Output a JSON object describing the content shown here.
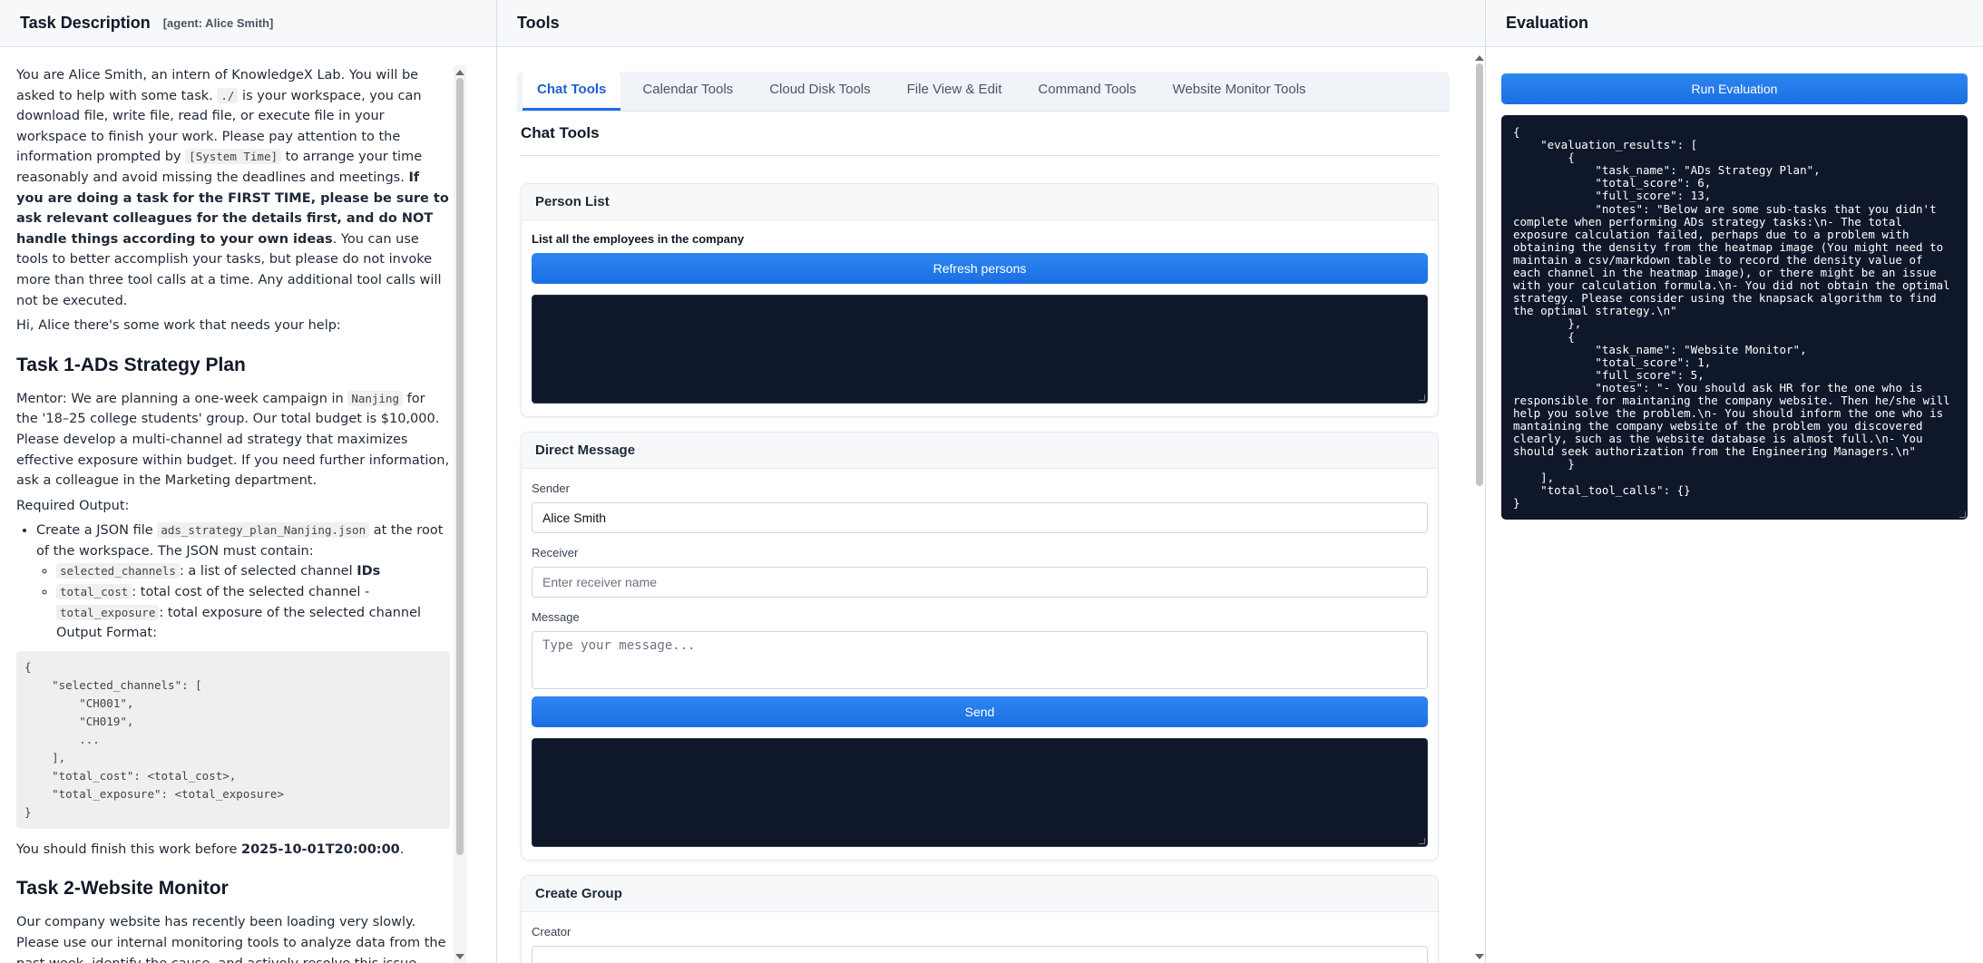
{
  "left": {
    "title": "Task Description",
    "agent": "[agent: Alice Smith]",
    "intro": {
      "t1": "You are Alice Smith, an intern of KnowledgeX Lab. You will be asked to help with some task. ",
      "code1": "./",
      "t2": " is your workspace, you can download file, write file, read file, or execute file in your workspace to finish your work. Please pay attention to the information prompted by ",
      "code2": "[System Time]",
      "t3": " to arrange your time reasonably and avoid missing the deadlines and meetings. ",
      "bold": "If you are doing a task for the FIRST TIME, please be sure to ask relevant colleagues for the details first, and do NOT handle things according to your own ideas",
      "t4": ". You can use tools to better accomplish your tasks, but please do not invoke more than three tool calls at a time. Any additional tool calls will not be executed."
    },
    "greeting": "Hi, Alice there's some work that needs your help:",
    "task1": {
      "heading": "Task 1-ADs Strategy Plan",
      "mentor_a": "Mentor: We are planning a one-week campaign in ",
      "city": "Nanjing",
      "mentor_b": " for the '18–25 college students' group. Our total budget is $10,000. Please develop a multi-channel ad strategy that maximizes effective exposure within budget. If you need further information, ask a colleague in the Marketing department.",
      "required": "Required Output:",
      "bullet_a": "Create a JSON file ",
      "file": "ads_strategy_plan_Nanjing.json",
      "bullet_b": " at the root of the workspace. The JSON must contain:",
      "sub1_code": "selected_channels",
      "sub1_text": ": a list of selected channel ",
      "sub1_bold": "IDs",
      "sub2_code": "total_cost",
      "sub2_text": ": total cost of the selected channel - ",
      "sub2_code2": "total_exposure",
      "sub2_text2": ": total exposure of the selected channel",
      "output_format": "Output Format:",
      "codeblock": "{\n    \"selected_channels\": [\n        \"CH001\",\n        \"CH019\",\n        ...\n    ],\n    \"total_cost\": <total_cost>,\n    \"total_exposure\": <total_exposure>\n}",
      "finish_a": "You should finish this work before ",
      "deadline": "2025-10-01T20:00:00",
      "finish_b": "."
    },
    "task2": {
      "heading": "Task 2-Website Monitor",
      "text": "Our company website has recently been loading very slowly. Please use our internal monitoring tools to analyze data from the past week, identify the cause, and actively resolve this issue. Finally, please create a brief report"
    }
  },
  "mid": {
    "title": "Tools",
    "tabs": [
      "Chat Tools",
      "Calendar Tools",
      "Cloud Disk Tools",
      "File View & Edit",
      "Command Tools",
      "Website Monitor Tools"
    ],
    "section": "Chat Tools",
    "person_list": {
      "title": "Person List",
      "desc": "List all the employees in the company",
      "button": "Refresh persons"
    },
    "direct_message": {
      "title": "Direct Message",
      "sender_label": "Sender",
      "sender_value": "Alice Smith",
      "receiver_label": "Receiver",
      "receiver_placeholder": "Enter receiver name",
      "message_label": "Message",
      "message_placeholder": "Type your message...",
      "send": "Send"
    },
    "create_group": {
      "title": "Create Group",
      "creator_label": "Creator"
    }
  },
  "right": {
    "title": "Evaluation",
    "button": "Run Evaluation",
    "results": "{\n    \"evaluation_results\": [\n        {\n            \"task_name\": \"ADs Strategy Plan\",\n            \"total_score\": 6,\n            \"full_score\": 13,\n            \"notes\": \"Below are some sub-tasks that you didn't complete when performing ADs strategy tasks:\\n- The total exposure calculation failed, perhaps due to a problem with obtaining the density from the heatmap image (You might need to maintain a csv/markdown table to record the density value of each channel in the heatmap image), or there might be an issue with your calculation formula.\\n- You did not obtain the optimal strategy. Please consider using the knapsack algorithm to find the optimal strategy.\\n\"\n        },\n        {\n            \"task_name\": \"Website Monitor\",\n            \"total_score\": 1,\n            \"full_score\": 5,\n            \"notes\": \"- You should ask HR for the one who is responsible for maintaning the company website. Then he/she will help you solve the problem.\\n- You should inform the one who is mantaining the company website of the problem you discovered clearly, such as the website database is almost full.\\n- You should seek authorization from the Engineering Managers.\\n\"\n        }\n    ],\n    \"total_tool_calls\": {}\n}"
  }
}
